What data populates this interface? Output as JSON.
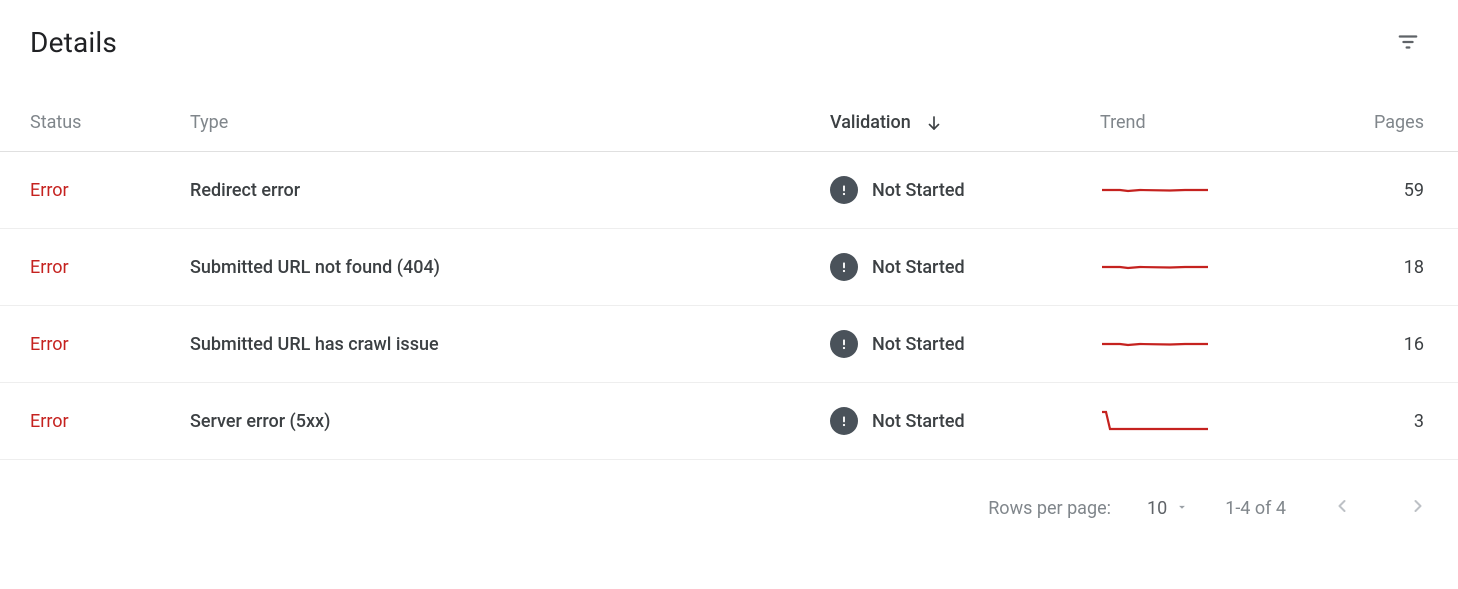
{
  "title": "Details",
  "columns": {
    "status": "Status",
    "type": "Type",
    "validation": "Validation",
    "trend": "Trend",
    "pages": "Pages"
  },
  "sort": {
    "column": "validation",
    "direction": "desc"
  },
  "rows": [
    {
      "status": "Error",
      "type": "Redirect error",
      "validation": "Not Started",
      "trend_shape": "flat",
      "pages": 59
    },
    {
      "status": "Error",
      "type": "Submitted URL not found (404)",
      "validation": "Not Started",
      "trend_shape": "flat",
      "pages": 18
    },
    {
      "status": "Error",
      "type": "Submitted URL has crawl issue",
      "validation": "Not Started",
      "trend_shape": "flat",
      "pages": 16
    },
    {
      "status": "Error",
      "type": "Server error (5xx)",
      "validation": "Not Started",
      "trend_shape": "drop",
      "pages": 3
    }
  ],
  "pagination": {
    "rows_per_page_label": "Rows per page:",
    "rows_per_page": 10,
    "range_label": "1-4 of 4"
  },
  "colors": {
    "error": "#c5221f",
    "trend": "#c5221f",
    "muted": "#80868b",
    "badge": "#4a525a"
  }
}
